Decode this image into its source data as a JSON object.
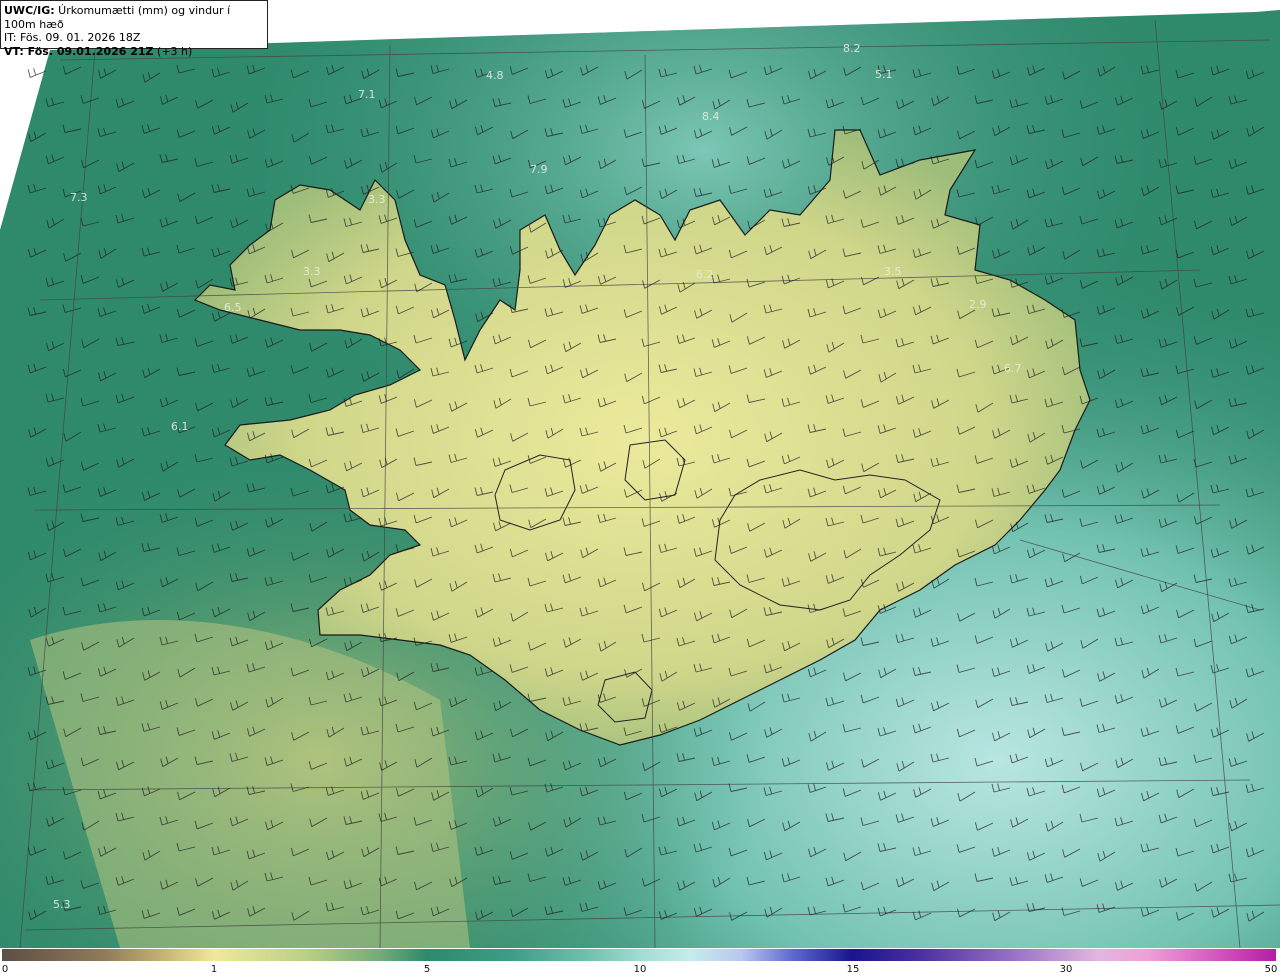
{
  "header": {
    "title_bold": "UWC/IG:",
    "title_rest": " Úrkomumætti (mm) og vindur í 100m hæð",
    "it_line": "IT: Fös. 09. 01. 2026 18Z",
    "vt_bold": "VT: Fös. 09.01.2026 21Z",
    "vt_rest": " (+3 h)"
  },
  "map_labels": [
    "4.8",
    "8.2",
    "5.1",
    "7.1",
    "8.4",
    "7.9",
    "7.3",
    "3.3",
    "3.3",
    "6.2",
    "3.5",
    "2.9",
    "6.5",
    "6.7",
    "6.1",
    "5.3"
  ],
  "colorbar": {
    "ticks": [
      "0",
      "1",
      "5",
      "10",
      "15",
      "30",
      "50"
    ]
  },
  "colors": {
    "land": "#d9d98a",
    "sea": "#2f8a6c",
    "sea_light": "#7fcfbf",
    "coast": "#1a1a1a"
  }
}
